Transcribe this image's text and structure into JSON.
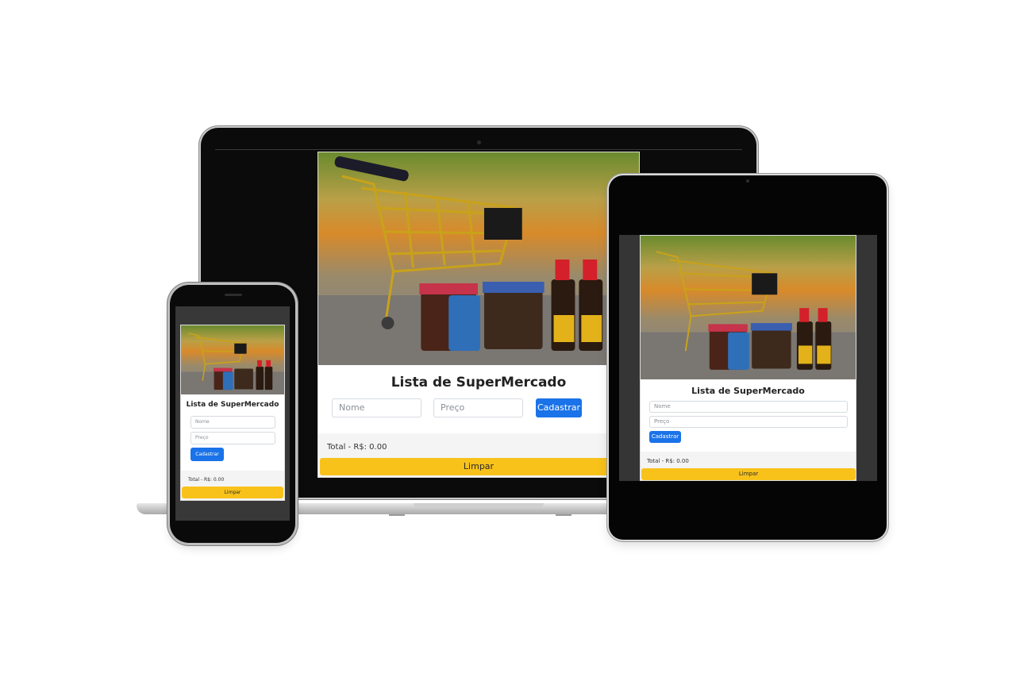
{
  "app": {
    "title": "Lista de SuperMercado",
    "name_placeholder": "Nome",
    "price_placeholder": "Preço",
    "submit_label": "Cadastrar",
    "total_label": "Total - R$: 0.00",
    "clear_label": "Limpar"
  },
  "colors": {
    "primary": "#1a73e8",
    "warning": "#f8c21b",
    "device_bezel": "#0b0b0b"
  },
  "icons": {
    "hero": "shopping-cart-photo"
  }
}
